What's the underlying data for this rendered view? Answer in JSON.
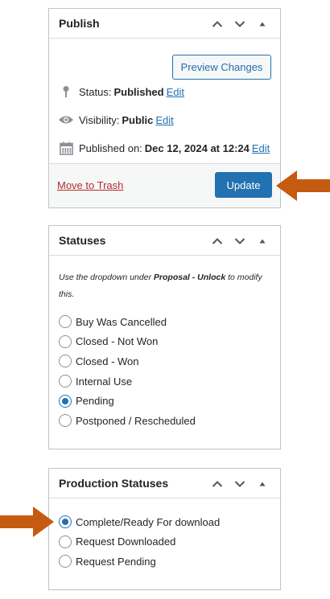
{
  "publish": {
    "title": "Publish",
    "preview_label": "Preview Changes",
    "status_label": "Status:",
    "status_value": "Published",
    "visibility_label": "Visibility:",
    "visibility_value": "Public",
    "published_label": "Published on:",
    "published_value": "Dec 12, 2024 at 12:24",
    "edit_label": "Edit",
    "trash_label": "Move to Trash",
    "update_label": "Update"
  },
  "statuses": {
    "title": "Statuses",
    "note_prefix": "Use the dropdown under",
    "note_bold": "Proposal - Unlock",
    "note_suffix": "to modify this.",
    "options": [
      {
        "label": "Buy Was Cancelled",
        "checked": false
      },
      {
        "label": "Closed - Not Won",
        "checked": false
      },
      {
        "label": "Closed - Won",
        "checked": false
      },
      {
        "label": "Internal Use",
        "checked": false
      },
      {
        "label": "Pending",
        "checked": true
      },
      {
        "label": "Postponed / Rescheduled",
        "checked": false
      }
    ]
  },
  "production": {
    "title": "Production Statuses",
    "options": [
      {
        "label": "Complete/Ready For download",
        "checked": true
      },
      {
        "label": "Request Downloaded",
        "checked": false
      },
      {
        "label": "Request Pending",
        "checked": false
      }
    ]
  },
  "colors": {
    "primary": "#2271b1",
    "danger": "#b32d2e",
    "arrow": "#c55a11"
  },
  "icons": [
    "chevron-up-icon",
    "chevron-down-icon",
    "triangle-up-icon",
    "pin-icon",
    "eye-icon",
    "calendar-icon",
    "arrow-icon"
  ]
}
